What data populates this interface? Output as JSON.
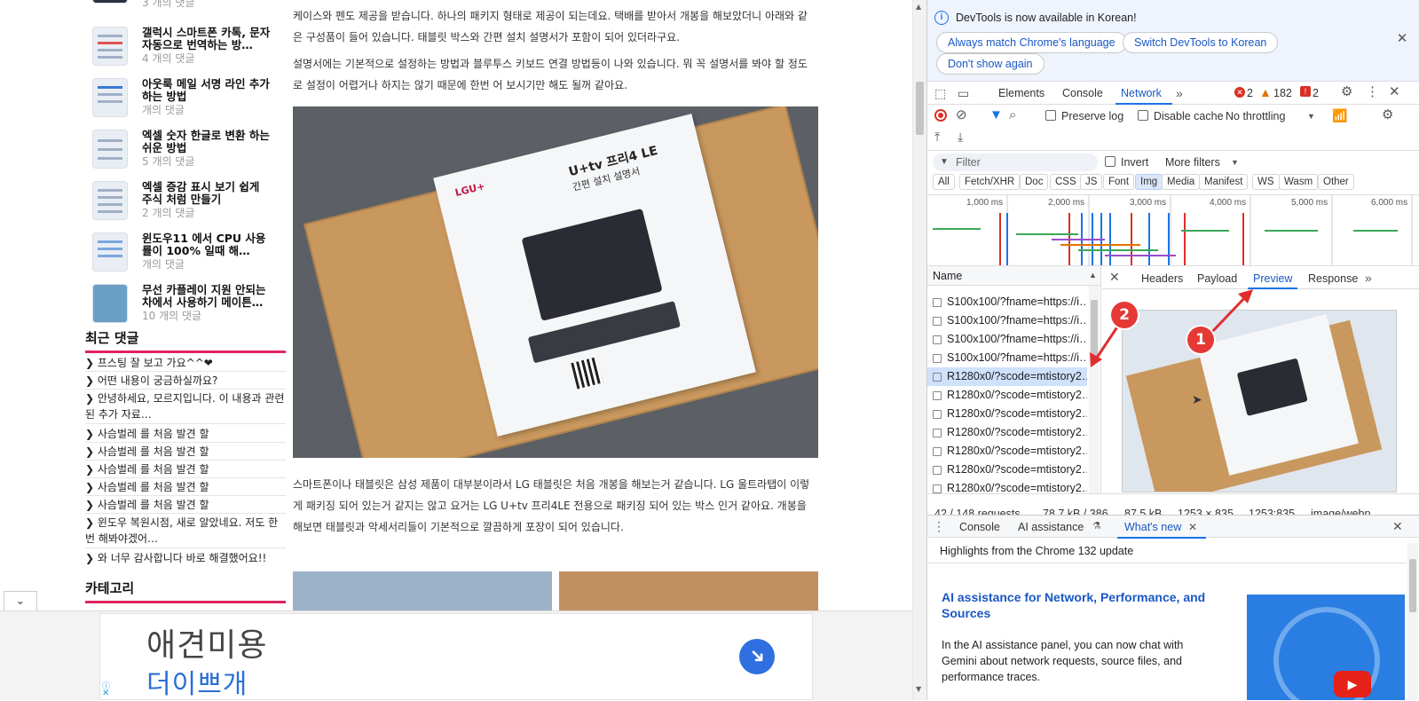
{
  "blog": {
    "sidebar_posts": [
      {
        "title": "",
        "count": "3 개의 댓글"
      },
      {
        "title": "갤럭시 스마트폰 카톡, 문자 자동으로 번역하는 방…",
        "count": "4 개의 댓글"
      },
      {
        "title": "아웃룩 메일 서명 라인 추가하는 방법",
        "count": "개의 댓글"
      },
      {
        "title": "엑셀 숫자 한글로 변환 하는 쉬운 방법",
        "count": "5 개의 댓글"
      },
      {
        "title": "엑셀 증감 표시 보기 쉽게 주식 처럼 만들기",
        "count": "2 개의 댓글"
      },
      {
        "title": "윈도우11 에서 CPU 사용률이 100% 일때 해…",
        "count": "개의 댓글"
      },
      {
        "title": "무선 카플레이 지원 안되는 차에서 사용하기 메이튼…",
        "count": "10 개의 댓글"
      }
    ],
    "recent_comments_heading": "최근 댓글",
    "recent_comments": [
      "프스팅 잘 보고 가요^^❤",
      "어떤 내용이 궁금하실까요?",
      "안녕하세요, 모르지입니다. 이 내용과 관련된 추가 자료…",
      "사슴벌레 를 처음 발견 할",
      "사슴벌레 를 처음 발견 할",
      "사슴벌레 를 처음 발견 할",
      "사슴벌레 를 처음 발견 할",
      "사슴벌레 를 처음 발견 할",
      "윈도우 복원시점, 새로 알았네요. 저도 한번 해봐야겠어…",
      "와 너무 감사합니다 바로 해결했어요!!"
    ],
    "category_heading": "카테고리",
    "paragraphs": [
      "케이스와 펜도 제공을 받습니다. 하나의 패키지 형태로 제공이 되는데요. 택배를 받아서 개봉을 해보았더니 아래와 같은 구성품이 들어 있습니다. 태블릿 박스와 간편 설치 설명서가 포함이 되어 있더라구요.",
      "설명서에는 기본적으로 설정하는 방법과 블루투스 키보드 연결 방법등이 나와 있습니다. 뭐 꼭 설명서를 봐야 할 정도로 설정이 어렵거나 하지는 않기 때문에 한번      어 보시기만 해도 될꺼 같아요.",
      "스마트폰이나 태블릿은 삼성 제품이 대부분이라서 LG 태블릿은 처음 개봉을 해보는거 같습니다. LG 울트라탭이 이렇게 패키징 되어 있는거 같지는 않고 요거는 LG U+tv 프리4LE 전용으로 패키징 되어 있는 박스 인거 같아요. 개봉을 해보면 태블릿과 악세서리들이 기본적으로 깔끔하게 포장이 되어 있습니다."
    ],
    "photo_brand": "LGU+",
    "photo_doc_title": "U+tv 프리4 LE",
    "photo_doc_subtitle": "간편 설치 설명서",
    "ad": {
      "line1": "애견미용",
      "line2": "더이쁘개"
    }
  },
  "devtools": {
    "info_text": "DevTools is now available in Korean!",
    "btn_match": "Always match Chrome's language",
    "btn_switch": "Switch DevTools to Korean",
    "btn_dont": "Don't show again",
    "main_tabs": [
      "Elements",
      "Console",
      "Network"
    ],
    "errors": "2",
    "warnings": "182",
    "issues": "2",
    "preserve_log": "Preserve log",
    "disable_cache": "Disable cache",
    "throttling": "No throttling",
    "filter_placeholder": "Filter",
    "invert": "Invert",
    "more_filters": "More filters",
    "type_filters": [
      "All",
      "Fetch/XHR",
      "Doc",
      "CSS",
      "JS",
      "Font",
      "Img",
      "Media",
      "Manifest",
      "WS",
      "Wasm",
      "Other"
    ],
    "active_filter": "Img",
    "timeline_ticks": [
      "1,000 ms",
      "2,000 ms",
      "3,000 ms",
      "4,000 ms",
      "5,000 ms",
      "6,000 ms"
    ],
    "name_header": "Name",
    "requests": [
      "S100x100/?fname=https://i…",
      "S100x100/?fname=https://i…",
      "S100x100/?fname=https://i…",
      "S100x100/?fname=https://i…",
      "R1280x0/?scode=mtistory2…",
      "R1280x0/?scode=mtistory2…",
      "R1280x0/?scode=mtistory2…",
      "R1280x0/?scode=mtistory2…",
      "R1280x0/?scode=mtistory2…",
      "R1280x0/?scode=mtistory2…",
      "R1280x0/?scode=mtistory2…"
    ],
    "detail_tabs": [
      "Headers",
      "Payload",
      "Preview",
      "Response"
    ],
    "active_detail_tab": "Preview",
    "status_requests": "42 / 148 requests",
    "status_transferred": "78.7 kB / 386",
    "preview_size": "87.5 kB",
    "preview_dims": "1253 × 835",
    "preview_ratio": "1253:835",
    "preview_mime": "image/webp",
    "drawer_tabs": [
      "Console",
      "AI assistance",
      "What's new"
    ],
    "drawer_heading": "Highlights from the Chrome 132 update",
    "whatsnew_title": "AI assistance for Network, Performance, and Sources",
    "whatsnew_body": "In the AI assistance panel, you can now chat with Gemini about network requests, source files, and performance traces."
  },
  "annotations": {
    "badge1": "1",
    "badge2": "2",
    "color": "#e53935"
  }
}
